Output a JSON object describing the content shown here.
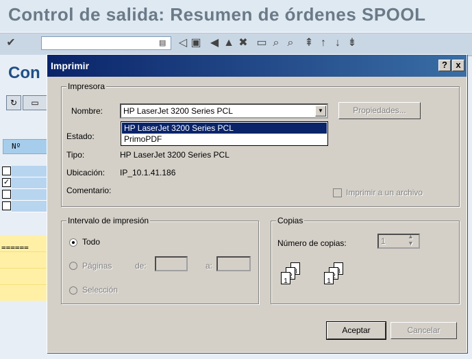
{
  "background": {
    "title": "Control de salida: Resumen de órdenes SPOOL",
    "subtitle": "Con",
    "column_header": "Nº",
    "filler": "======"
  },
  "dialog": {
    "title": "Imprimir",
    "help_button": "?",
    "close_button": "x",
    "printer_group": {
      "legend": "Impresora",
      "name_label": "Nombre:",
      "name_value": "HP LaserJet 3200 Series PCL",
      "properties_button": "Propiedades...",
      "status_label": "Estado:",
      "type_label": "Tipo:",
      "type_value": "HP LaserJet 3200 Series PCL",
      "location_label": "Ubicación:",
      "location_value": "IP_10.1.41.186",
      "comment_label": "Comentario:",
      "print_to_file_label": "Imprimir a un archivo",
      "dropdown_options": [
        "HP LaserJet 3200 Series PCL",
        "PrimoPDF"
      ]
    },
    "range_group": {
      "legend": "Intervalo de impresión",
      "all_label": "Todo",
      "pages_label": "Páginas",
      "from_label": "de:",
      "to_label": "a:",
      "selection_label": "Selección"
    },
    "copies_group": {
      "legend": "Copias",
      "count_label": "Número de copias:",
      "count_value": "1"
    },
    "ok_button": "Aceptar",
    "cancel_button": "Cancelar"
  }
}
